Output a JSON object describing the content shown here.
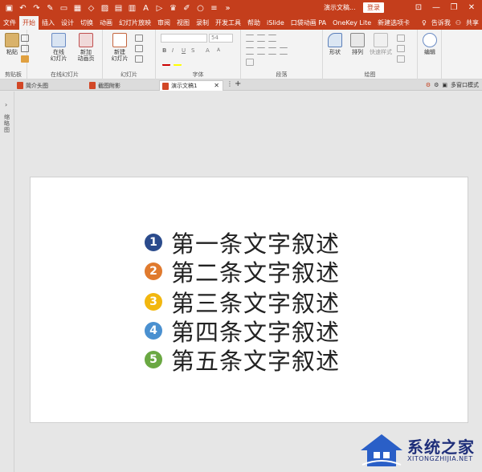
{
  "titlebar": {
    "document_title": "演示文稿...",
    "login_label": "登录",
    "quick_access": [
      "save-icon",
      "undo-icon",
      "redo-icon",
      "format-painter-icon",
      "new-slide-icon",
      "table-icon",
      "shapes-icon",
      "picture-icon",
      "grid-icon",
      "chart-icon",
      "textbox-icon",
      "present-icon",
      "crown-icon",
      "pen-icon",
      "circle-icon",
      "align-icon",
      "more-icon"
    ],
    "window_controls": [
      "minimize-icon",
      "restore-icon",
      "close-icon"
    ]
  },
  "ribbon_tabs": {
    "items": [
      "文件",
      "开始",
      "插入",
      "设计",
      "切换",
      "动画",
      "幻灯片放映",
      "审阅",
      "视图",
      "录制",
      "开发工具",
      "帮助",
      "iSlide",
      "口袋动画 PA",
      "OneKey Lite",
      "新建选项卡"
    ],
    "active_index": 1,
    "tell_me": "告诉我",
    "share": "共享"
  },
  "ribbon": {
    "clipboard": {
      "paste": "粘贴",
      "label": "剪贴板"
    },
    "online_slides": {
      "online": "在线\n幻灯片",
      "new_anim": "新加\n动画页",
      "label": "在线幻灯片"
    },
    "slides": {
      "new_slide": "新建\n幻灯片",
      "label": "幻灯片"
    },
    "font": {
      "size": "54",
      "label": "字体"
    },
    "paragraph": {
      "label": "段落"
    },
    "drawing": {
      "shape": "形状",
      "arrange": "排列",
      "quick_styles": "快速样式",
      "label": "绘图"
    },
    "editing": {
      "label": "编辑"
    }
  },
  "doc_tabs": {
    "tabs": [
      "简介头图",
      "截图附影",
      "演示文稿1"
    ],
    "active_index": 2,
    "multi_window": "多窗口模式"
  },
  "side_panel": {
    "label": "缩略图"
  },
  "slide": {
    "items": [
      {
        "num": "1",
        "text": "第一条文字叙述",
        "color": "#2b4b8c"
      },
      {
        "num": "2",
        "text": "第二条文字叙述",
        "color": "#e07a2e"
      },
      {
        "num": "3",
        "text": "第三条文字叙述",
        "color": "#f2b70f"
      },
      {
        "num": "4",
        "text": "第四条文字叙述",
        "color": "#4a90d0"
      },
      {
        "num": "5",
        "text": "第五条文字叙述",
        "color": "#6aa842"
      }
    ]
  },
  "watermark": {
    "brand": "系统之家",
    "url": "XITONGZHIJIA.NET"
  },
  "colors": {
    "accent": "#c43e1c"
  }
}
